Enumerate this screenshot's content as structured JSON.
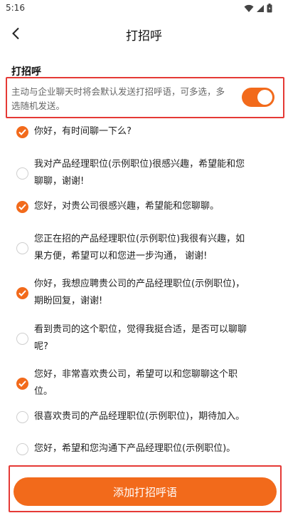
{
  "status_bar": {
    "time": "5:16"
  },
  "header": {
    "title": "打招呼",
    "back_icon": "chevron-left-icon"
  },
  "section": {
    "title": "打招呼"
  },
  "auto_greet": {
    "description": "主动与企业聊天时将会默认发送打招呼语，可多选，多选随机发送。",
    "enabled": true,
    "accent_color": "#f26a1b"
  },
  "greetings": [
    {
      "lines": [
        "你好，有时间聊一下么?"
      ],
      "checked": true
    },
    {
      "lines": [
        "我对产品经理职位(示例职位)很感兴趣，希望能和您",
        "聊聊，谢谢!"
      ],
      "checked": false
    },
    {
      "lines": [
        "您好，对贵公司很感兴趣，希望能和您聊聊。"
      ],
      "checked": true
    },
    {
      "lines": [
        "您正在招的产品经理职位(示例职位)我很有兴趣，如",
        "果方便，希望可以和您进一步沟通， 谢谢!"
      ],
      "checked": false
    },
    {
      "lines": [
        "你好，我想应聘贵公司的产品经理职位(示例职位)，",
        "期盼回复，谢谢!"
      ],
      "checked": true
    },
    {
      "lines": [
        "看到贵司的这个职位，觉得我挺合适，是否可以聊聊",
        "呢?"
      ],
      "checked": false
    },
    {
      "lines": [
        "您好，非常喜欢贵公司，希望可以和您聊聊这个职",
        "位。"
      ],
      "checked": true
    },
    {
      "lines": [
        "很喜欢贵司的产品经理职位(示例职位)，期待加入。"
      ],
      "checked": false
    },
    {
      "lines": [
        "您好，希望和您沟通下产品经理职位(示例职位)。"
      ],
      "checked": false
    }
  ],
  "footer": {
    "add_button_label": "添加打招呼语"
  },
  "colors": {
    "accent": "#f26a1b",
    "highlight_border": "#e53935"
  }
}
